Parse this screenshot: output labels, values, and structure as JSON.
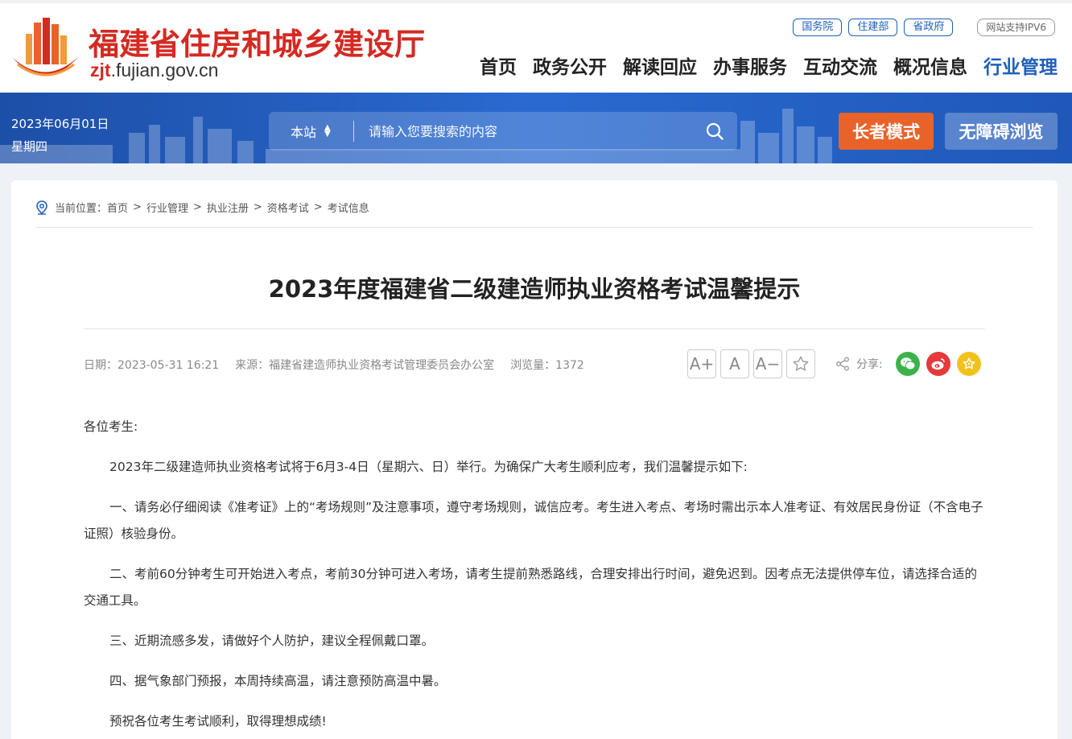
{
  "header": {
    "site_title": "福建省住房和城乡建设厅",
    "domain_prefix": "zjt",
    "domain_suffix": ".fujian.gov.cn",
    "top_links": [
      "国务院",
      "住建部",
      "省政府"
    ],
    "ipv6": "网站支持IPV6",
    "nav": [
      "首页",
      "政务公开",
      "解读回应",
      "办事服务",
      "互动交流",
      "概况信息",
      "行业管理"
    ],
    "active_nav": "行业管理"
  },
  "banner": {
    "date": "2023年06月01日",
    "weekday": "星期四",
    "search_scope": "本站",
    "search_placeholder": "请输入您要搜索的内容",
    "elder_mode": "长者模式",
    "accessible": "无障碍浏览"
  },
  "breadcrumb": {
    "label": "当前位置：",
    "items": [
      "首页",
      "行业管理",
      "执业注册",
      "资格考试",
      "考试信息"
    ],
    "separator": ">"
  },
  "article": {
    "title": "2023年度福建省二级建造师执业资格考试温馨提示",
    "date": "日期：2023-05-31 16:21",
    "source": "来源：福建省建造师执业资格考试管理委员会办公室",
    "views": "浏览量：1372",
    "font_large": "A+",
    "font_normal": "A",
    "font_small": "A−",
    "share_label": "分享:",
    "paragraphs": [
      "各位考生:",
      "2023年二级建造师执业资格考试将于6月3-4日（星期六、日）举行。为确保广大考生顺利应考，我们温馨提示如下:",
      "一、请务必仔细阅读《准考证》上的“考场规则”及注意事项，遵守考场规则，诚信应考。考生进入考点、考场时需出示本人准考证、有效居民身份证（不含电子证照）核验身份。",
      "二、考前60分钟考生可开始进入考点，考前30分钟可进入考场，请考生提前熟悉路线，合理安排出行时间，避免迟到。因考点无法提供停车位，请选择合适的交通工具。",
      "三、近期流感多发，请做好个人防护，建议全程佩戴口罩。",
      "四、据气象部门预报，本周持续高温，请注意预防高温中暑。",
      "预祝各位考生考试顺利，取得理想成绩!"
    ]
  },
  "colors": {
    "brand_red": "#d32a22",
    "brand_blue": "#1e5fb8",
    "elder_orange": "#e8632a",
    "wechat_green": "#3bb34a",
    "weibo_red": "#e5393b",
    "fav_yellow": "#f1c21c"
  }
}
